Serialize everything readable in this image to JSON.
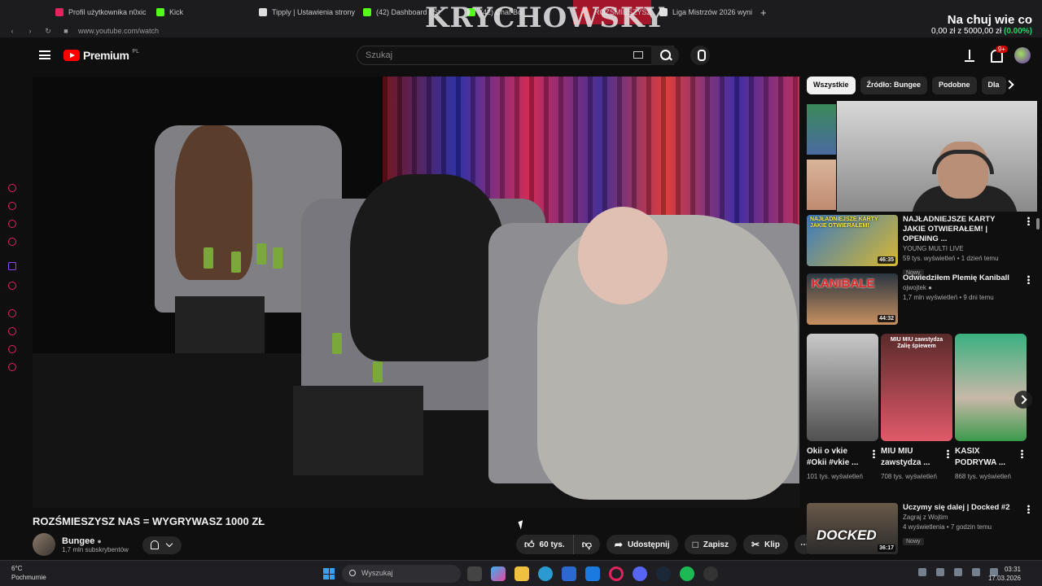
{
  "browser": {
    "tabs": [
      {
        "label": "Profil użytkownika n0xic",
        "color": "#e0245e"
      },
      {
        "label": "Kick",
        "color": "#53fc18"
      },
      {
        "label": "Tipply | Ustawienia strony",
        "color": "#ffffff"
      },
      {
        "label": "(42) Dashboard / St",
        "color": "#53fc18"
      },
      {
        "label": "(42) Chat Bo",
        "color": "#53fc18"
      },
      {
        "label": "ROZŚMIESZYSZ",
        "color": "#ff0000"
      },
      {
        "label": "Liga Mistrzów 2026 wyni",
        "color": "#e0e0e0"
      }
    ],
    "url": "www.youtube.com/watch"
  },
  "stream_overlay": {
    "title": "KRYCHOWSKY",
    "donation_title": "Na chuj wie co",
    "donation_amount": "0,00 zł z 5000,00 zł",
    "donation_percent": "(0.00%)",
    "donation_progress": 0.0
  },
  "header": {
    "logo_text": "Premium",
    "country": "PL",
    "search_placeholder": "Szukaj",
    "notifications_badge": "9+"
  },
  "video": {
    "title": "ROZŚMIESZYSZ NAS = WYGRYWASZ 1000 ZŁ",
    "channel": "Bungee",
    "subscribers": "1,7 mln subskrybentów",
    "likes": "60 tys.",
    "share": "Udostępnij",
    "save": "Zapisz",
    "clip": "Klip"
  },
  "chips": [
    "Wszystkie",
    "Źródło: Bungee",
    "Podobne",
    "Dla"
  ],
  "recommendations": [
    {
      "title": "NAJŁADNIEJSZE KARTY JAKIE OTWIERAŁEM! | OPENING ...",
      "channel": "YOUNG MULTI LIVE",
      "stats": "59 tys. wyświetleń • 1 dzień temu",
      "duration": "46:35",
      "badge": "Nowy"
    },
    {
      "title": "Odwiedziłem Plemię Kaniball",
      "channel": "ojwojtek",
      "stats": "1,7 mln wyświetleń • 9 dni temu",
      "duration": "44:32",
      "badge": ""
    },
    {
      "title": "Uczymy się dalej | Docked #2",
      "channel": "Zagraj z Wojtim",
      "stats": "4 wyświetlenia • 7 godzin temu",
      "duration": "36:17",
      "badge": "Nowy"
    }
  ],
  "shorts": [
    {
      "title": "Okii o vkie #Okii #vkie ...",
      "views": "101 tys. wyświetleń"
    },
    {
      "title": "MIU MIU zawstydza ...",
      "views": "708 tys. wyświetleń",
      "overlay": "MIU MIU zawstydza Zalię śpiewem"
    },
    {
      "title": "KASIX PODRYWA ...",
      "views": "868 tys. wyświetleń"
    }
  ],
  "thumb_texts": {
    "rec1": "NAJŁADNIEJSZE KARTY JAKIE OTWIERAŁEM!",
    "rec2": "KANIBALE",
    "rec3": "DOCKED"
  },
  "taskbar": {
    "weather_temp": "6°C",
    "weather_desc": "Pochmurnie",
    "search": "Wyszukaj",
    "time": "03:31",
    "date": "17.03.2026"
  }
}
